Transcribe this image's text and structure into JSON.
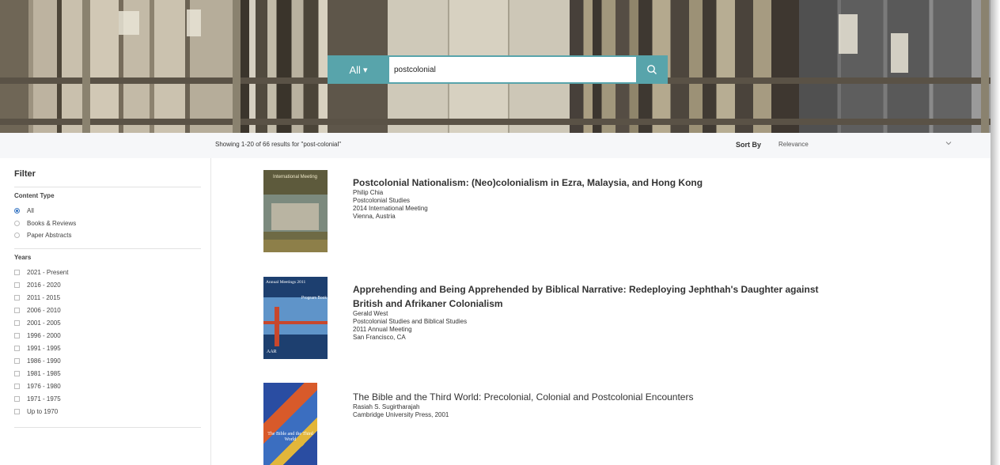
{
  "search": {
    "scope_label": "All",
    "scope_caret": "▾",
    "query": "postcolonial",
    "button_icon": "search-icon"
  },
  "results_header": {
    "showing": "Showing 1-20 of 66 results for \"post-colonial\"",
    "sort_label": "Sort By",
    "sort_value": "Relevance"
  },
  "filter": {
    "title": "Filter",
    "content_type": {
      "heading": "Content Type",
      "options": [
        {
          "label": "All",
          "selected": true
        },
        {
          "label": "Books & Reviews",
          "selected": false
        },
        {
          "label": "Paper Abstracts",
          "selected": false
        }
      ]
    },
    "years": {
      "heading": "Years",
      "options": [
        "2021 - Present",
        "2016 - 2020",
        "2011 - 2015",
        "2006 - 2010",
        "2001 - 2005",
        "1996 - 2000",
        "1991 - 1995",
        "1986 - 1990",
        "1981 - 1985",
        "1976 - 1980",
        "1971 - 1975",
        "Up to 1970"
      ]
    }
  },
  "results": [
    {
      "title": "Postcolonial Nationalism: (Neo)colonialism in Ezra, Malaysia, and Hong Kong",
      "lines": [
        "Philip Chia",
        "Postcolonial Studies",
        "2014 International Meeting",
        "Vienna, Austria"
      ],
      "cover_text": "International Meeting",
      "cover_footer": ""
    },
    {
      "title": "Apprehending and Being Apprehended by Biblical Narrative: Redeploying Jephthah's Daughter against",
      "title_line2": "British and Afrikaner Colonialism",
      "lines": [
        "Gerald West",
        "Postcolonial Studies and Biblical Studies",
        "2011 Annual Meeting",
        "San Francisco, CA"
      ],
      "cover_text": "Annual Meetings 2011",
      "cover_sub": "Program Book",
      "cover_footer": "AAR"
    },
    {
      "title": "The Bible and the Third World: Precolonial, Colonial and Postcolonial Encounters",
      "lines": [
        "Rasiah S. Sugirtharajah",
        "Cambridge University Press, 2001"
      ],
      "cover_text": "The Bible and the Third World"
    }
  ]
}
